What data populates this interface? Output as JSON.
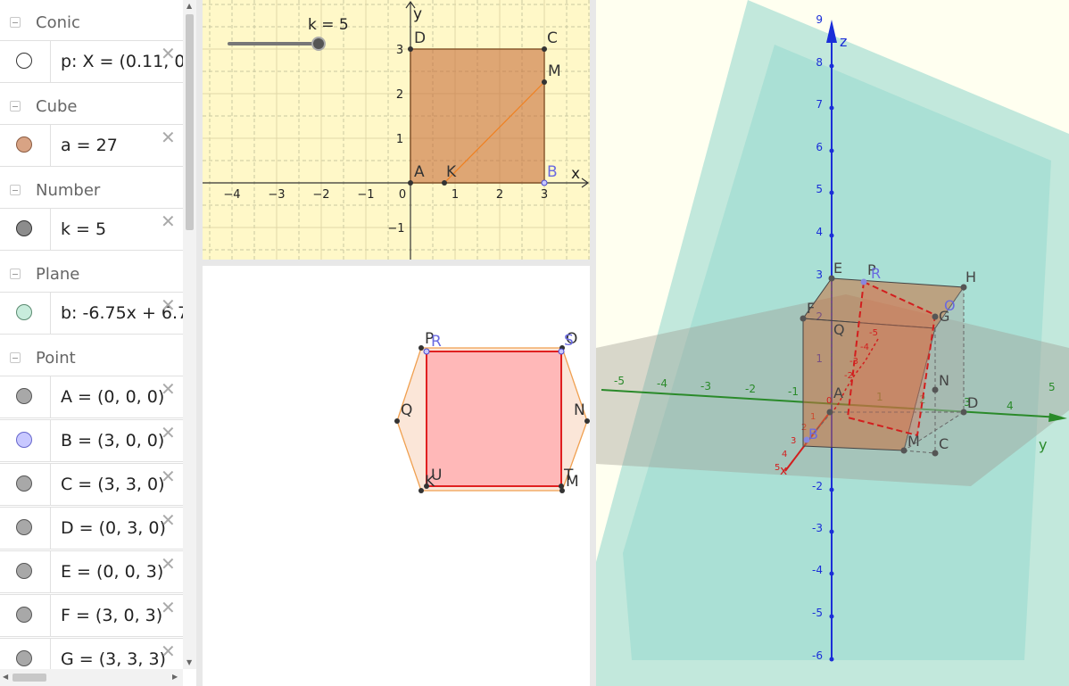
{
  "algebra": {
    "groups": [
      {
        "title": "Conic",
        "items": [
          {
            "def": "p: X = (0.11, 0",
            "color": "#ffffff"
          }
        ]
      },
      {
        "title": "Cube",
        "items": [
          {
            "def": "a = 27",
            "color": "#d8a384"
          }
        ]
      },
      {
        "title": "Number",
        "items": [
          {
            "def": "k = 5",
            "color": "#8c8c8c"
          }
        ]
      },
      {
        "title": "Plane",
        "items": [
          {
            "def": "b: -6.75x + 6.7",
            "color": "#c8ecdc"
          }
        ]
      },
      {
        "title": "Point",
        "items": [
          {
            "def": "A = (0, 0, 0)",
            "color": "#a8a8a8"
          },
          {
            "def": "B = (3, 0, 0)",
            "color": "#c8c8ff"
          },
          {
            "def": "C = (3, 3, 0)",
            "color": "#a8a8a8"
          },
          {
            "def": "D = (0, 3, 0)",
            "color": "#a8a8a8"
          },
          {
            "def": "E = (0, 0, 3)",
            "color": "#a8a8a8"
          },
          {
            "def": "F = (3, 0, 3)",
            "color": "#a8a8a8"
          },
          {
            "def": "G = (3, 3, 3)",
            "color": "#a8a8a8"
          }
        ]
      }
    ],
    "delete_icon": "close-icon"
  },
  "graphics2d": {
    "slider_label": "k = 5",
    "axis_x": "x",
    "axis_y": "y",
    "x_ticks": [
      "−4",
      "−3",
      "−2",
      "−1",
      "0",
      "1",
      "2",
      "3"
    ],
    "y_ticks": [
      "3",
      "2",
      "1",
      "−1"
    ],
    "points": {
      "A": "A",
      "B": "B",
      "C": "C",
      "D": "D",
      "K": "K",
      "M": "M"
    }
  },
  "graphics2b": {
    "labels": {
      "P": "P",
      "R": "R",
      "O": "O",
      "S": "S",
      "Q": "Q",
      "N": "N",
      "U": "U",
      "K": "K",
      "T": "T",
      "M": "M"
    }
  },
  "graphics3d": {
    "z_label": "z",
    "y_label": "y",
    "x_label": "x",
    "z_ticks": [
      "9",
      "8",
      "7",
      "6",
      "5",
      "4",
      "3",
      "2",
      "1",
      "-2",
      "-3",
      "-4",
      "-5",
      "-6"
    ],
    "y_ticks": [
      "-5",
      "-4",
      "-3",
      "-2",
      "-1",
      "1",
      "2",
      "3",
      "4",
      "5"
    ],
    "x_ticks": [
      "5",
      "4",
      "3",
      "2",
      "1"
    ],
    "inner_ticks": [
      "-5",
      "-4",
      "-3",
      "-2",
      "0"
    ],
    "points": {
      "E": "E",
      "P": "P",
      "R": "R",
      "H": "H",
      "F": "F",
      "Q": "Q",
      "G": "G",
      "O": "O",
      "N": "N",
      "D": "D",
      "M": "M",
      "C": "C",
      "B": "B",
      "A": "A"
    }
  },
  "colors": {
    "cube_fill": "#c8703c",
    "plane_fill": "#8fd6cc",
    "slice_red": "#d21e1e",
    "graph_bg": "#fff8c8",
    "axis_blue": "#1a2ed8",
    "axis_green": "#2a8a2a",
    "axis_red": "#d21e1e"
  }
}
